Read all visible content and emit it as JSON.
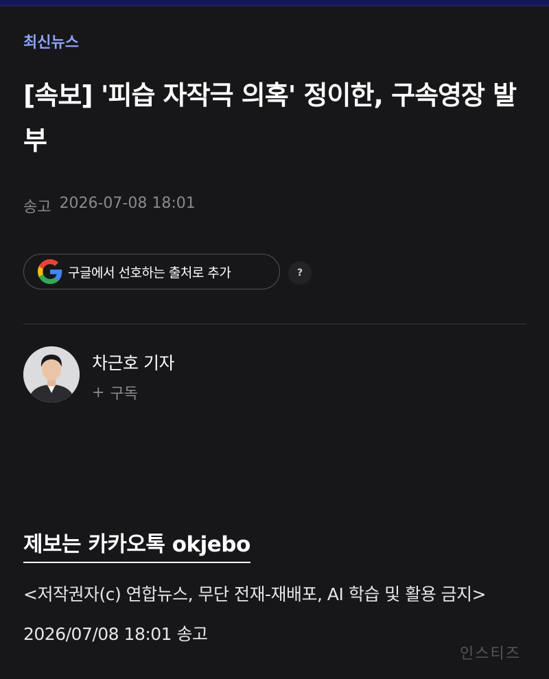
{
  "article": {
    "category": "최신뉴스",
    "headline": "[속보] '피습 자작극 의혹' 정이한, 구속영장 발부",
    "sent_label": "송고",
    "sent_datetime": "2026-07-08 18:01"
  },
  "google_source": {
    "label": "구글에서 선호하는 출처로 추가",
    "icon": "google-g-icon",
    "help_label": "?"
  },
  "reporter": {
    "name": "차근호 기자",
    "subscribe_label": "구독",
    "subscribe_icon": "plus-icon"
  },
  "body": {
    "tip_line": "제보는 카카오톡 okjebo",
    "copyright": "<저작권자(c) 연합뉴스, 무단 전재-재배포, AI 학습 및 활용 금지> 2026/07/08 18:01 송고"
  },
  "watermark": "인스티즈",
  "colors": {
    "background": "#171719",
    "accent": "#8fa3ff",
    "top_bar": "#14185a",
    "muted_text": "#8a8a8e"
  }
}
